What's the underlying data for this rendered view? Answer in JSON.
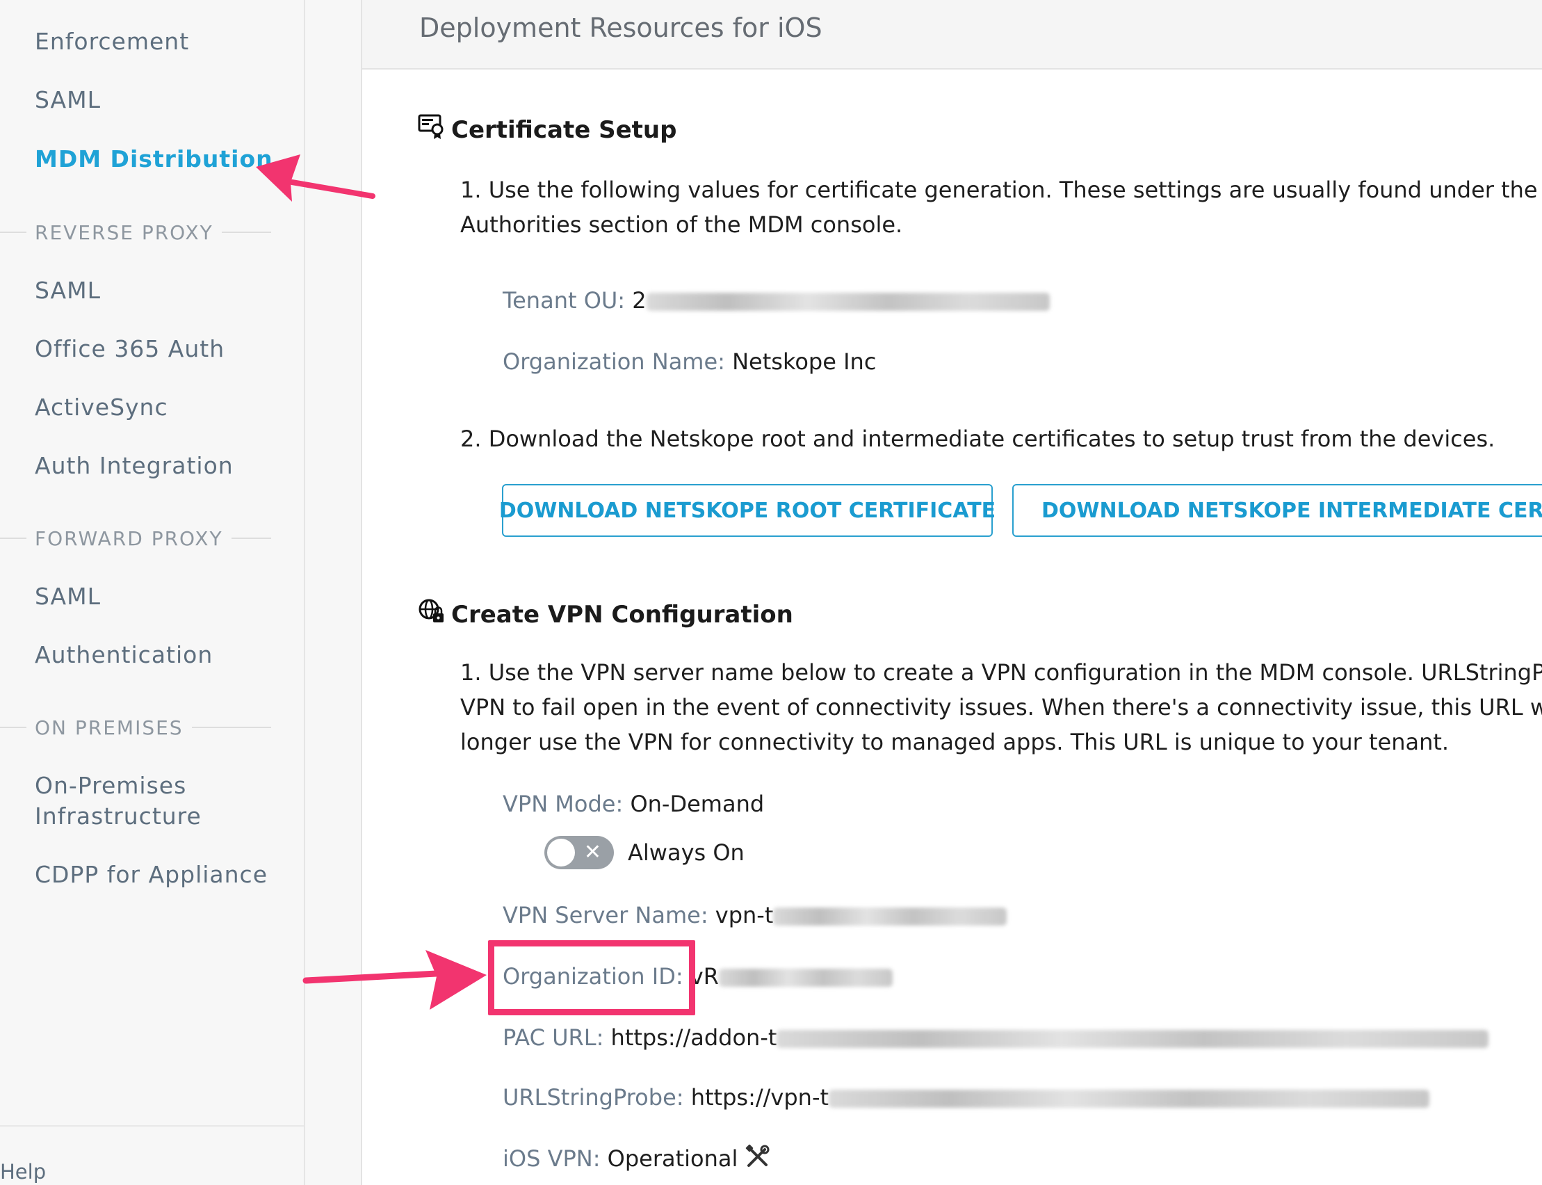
{
  "sidebar": {
    "items_top": [
      {
        "label": "Enforcement"
      },
      {
        "label": "SAML"
      },
      {
        "label": "MDM Distribution",
        "active": true
      }
    ],
    "sections": [
      {
        "title": "REVERSE PROXY",
        "items": [
          "SAML",
          "Office 365 Auth",
          "ActiveSync",
          "Auth Integration"
        ]
      },
      {
        "title": "FORWARD PROXY",
        "items": [
          "SAML",
          "Authentication"
        ]
      },
      {
        "title": "ON PREMISES",
        "items": [
          "On-Premises Infrastructure",
          "CDPP for Appliance"
        ]
      }
    ],
    "on_prem_line1": "On-Premises",
    "on_prem_line2": "Infrastructure",
    "help_label": "Help"
  },
  "header": {
    "title": "Deployment Resources for iOS"
  },
  "certificate": {
    "title": "Certificate Setup",
    "step1_line1": "1. Use the following values for certificate generation. These settings are usually found under the SCEP c",
    "step1_line2": "Authorities section of the MDM console.",
    "tenant_ou_label": "Tenant OU:",
    "tenant_ou_value": "2",
    "org_name_label": "Organization Name:",
    "org_name_value": "Netskope Inc",
    "step2": "2. Download the Netskope root and intermediate certificates to setup trust from the devices.",
    "btn_root": "DOWNLOAD NETSKOPE ROOT CERTIFICATE",
    "btn_intermediate": "DOWNLOAD NETSKOPE INTERMEDIATE CERTIFICA"
  },
  "vpn": {
    "title": "Create VPN Configuration",
    "step1_line1": "1. Use the VPN server name below to create a VPN configuration in the MDM console. URLStringProbe",
    "step1_line2": "VPN to fail open in the event of connectivity issues. When there's a connectivity issue, this URL will not",
    "step1_line3": "longer use the VPN for connectivity to managed apps. This URL is unique to your tenant.",
    "mode_label": "VPN Mode:",
    "mode_value": "On-Demand",
    "always_on_label": "Always On",
    "always_on_enabled": false,
    "server_label": "VPN Server Name:",
    "server_value": "vpn-t",
    "org_id_label": "Organization ID:",
    "org_id_value": "vR",
    "pac_label": "PAC URL:",
    "pac_value": "https://addon-t",
    "probe_label": "URLStringProbe:",
    "probe_value": "https://vpn-t",
    "ios_label": "iOS VPN:",
    "ios_value": "Operational"
  },
  "colors": {
    "accent": "#1fa2d6",
    "annotation": "#f2346f",
    "sidebar_text": "#5d6e7e"
  },
  "icons": [
    "certificate-icon",
    "vpn-globe-lock-icon",
    "tools-icon",
    "toggle-x-icon"
  ]
}
